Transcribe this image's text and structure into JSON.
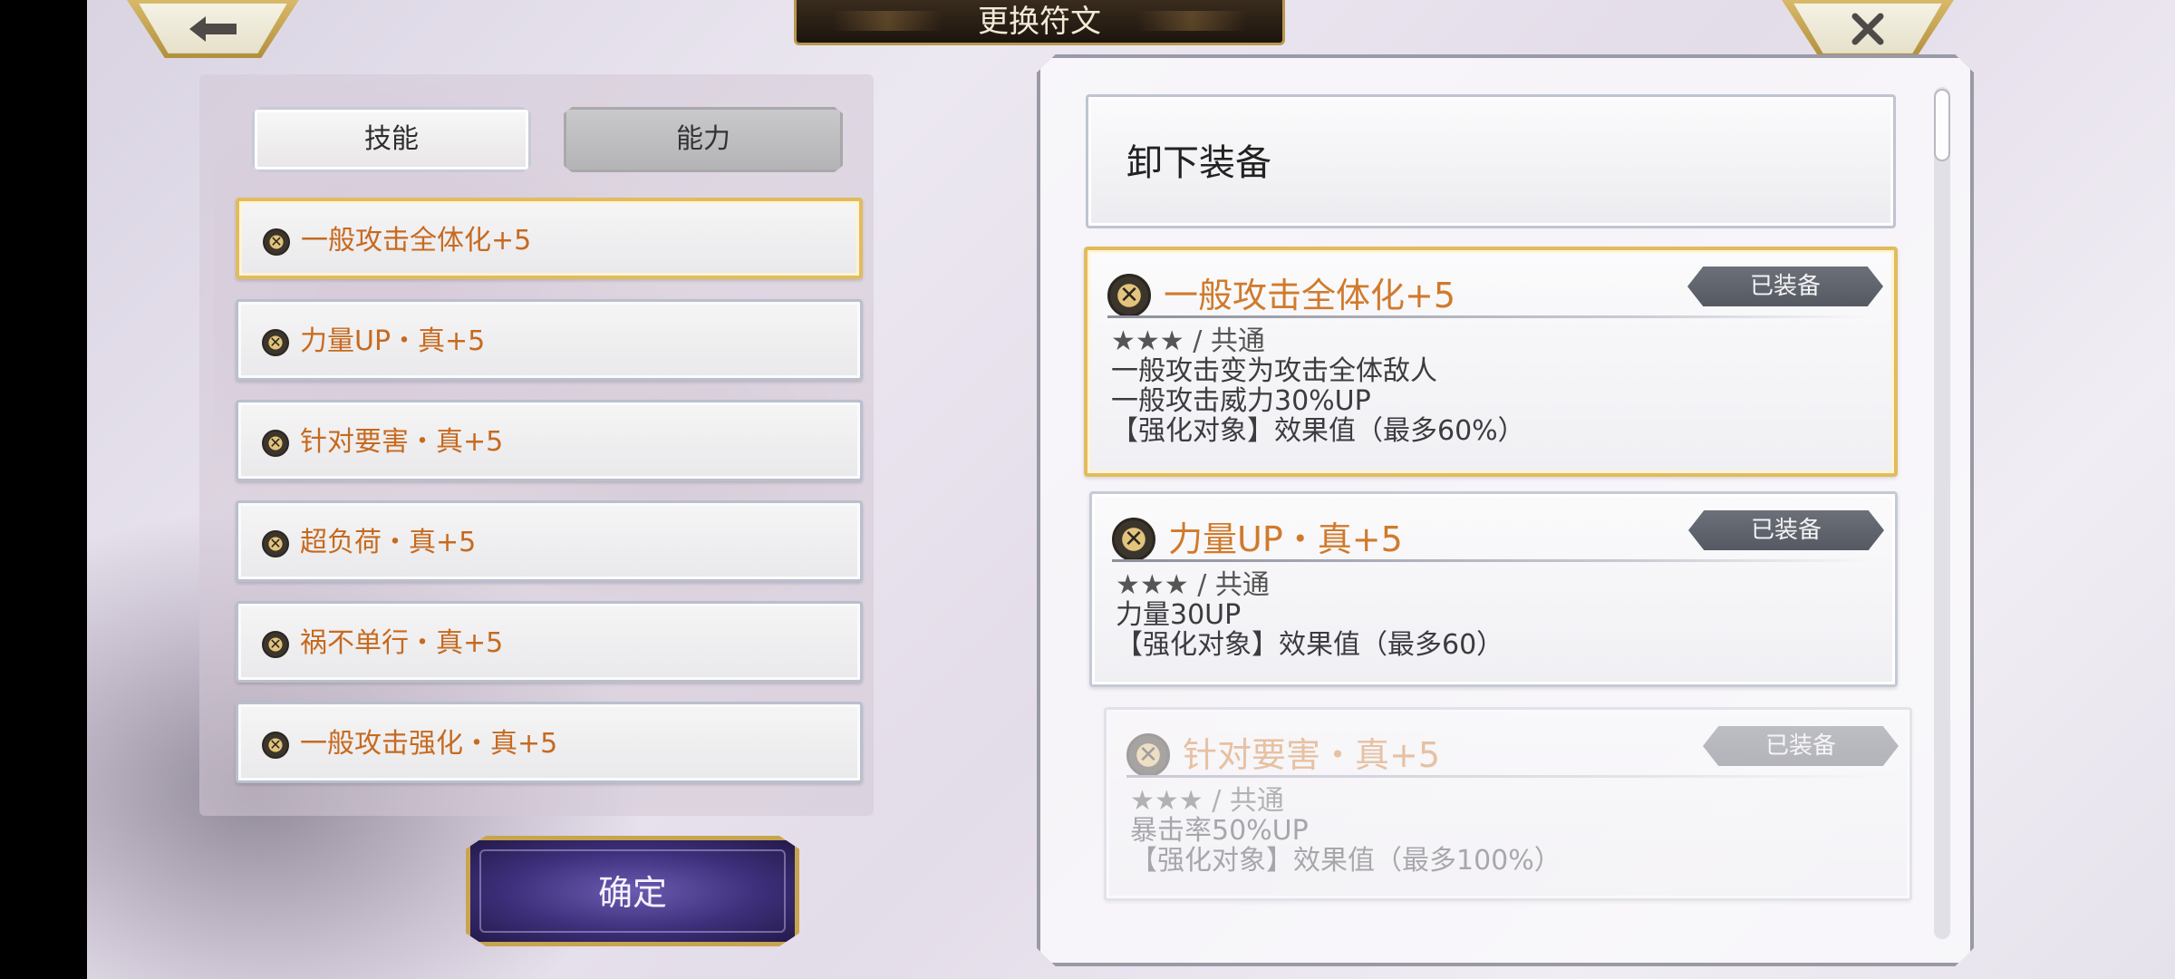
{
  "header": {
    "title": "更换符文",
    "back_glyph": "🡐",
    "close_glyph": "✕"
  },
  "tabs": {
    "skill": "技能",
    "ability": "能力"
  },
  "rune_list": [
    {
      "name": "一般攻击全体化+5",
      "selected": true
    },
    {
      "name": "力量UP・真+5",
      "selected": false
    },
    {
      "name": "针对要害・真+5",
      "selected": false
    },
    {
      "name": "超负荷・真+5",
      "selected": false
    },
    {
      "name": "祸不单行・真+5",
      "selected": false
    },
    {
      "name": "一般攻击强化・真+5",
      "selected": false
    }
  ],
  "confirm_label": "确定",
  "unequip_label": "卸下装备",
  "detail_cards": [
    {
      "name": "一般攻击全体化+5",
      "badge": "已装备",
      "rarity": "★★★ / 共通",
      "lines": [
        "一般攻击变为攻击全体敌人",
        "一般攻击威力30%UP",
        "【强化对象】效果值（最多60%）"
      ]
    },
    {
      "name": "力量UP・真+5",
      "badge": "已装备",
      "rarity": "★★★ / 共通",
      "lines": [
        "力量30UP",
        "【强化对象】效果值（最多60）"
      ]
    },
    {
      "name": "针对要害・真+5",
      "badge": "已装备",
      "rarity": "★★★ / 共通",
      "lines": [
        "暴击率50%UP",
        "【强化对象】效果值（最多100%）"
      ]
    }
  ],
  "colors": {
    "accent_gold": "#e2bb5e",
    "rune_name": "#c66a1f",
    "confirm_purple": "#3d2f7a"
  },
  "icons": {
    "rune": "rune-emblem-icon",
    "back": "back-arrow-icon",
    "close": "close-icon"
  }
}
